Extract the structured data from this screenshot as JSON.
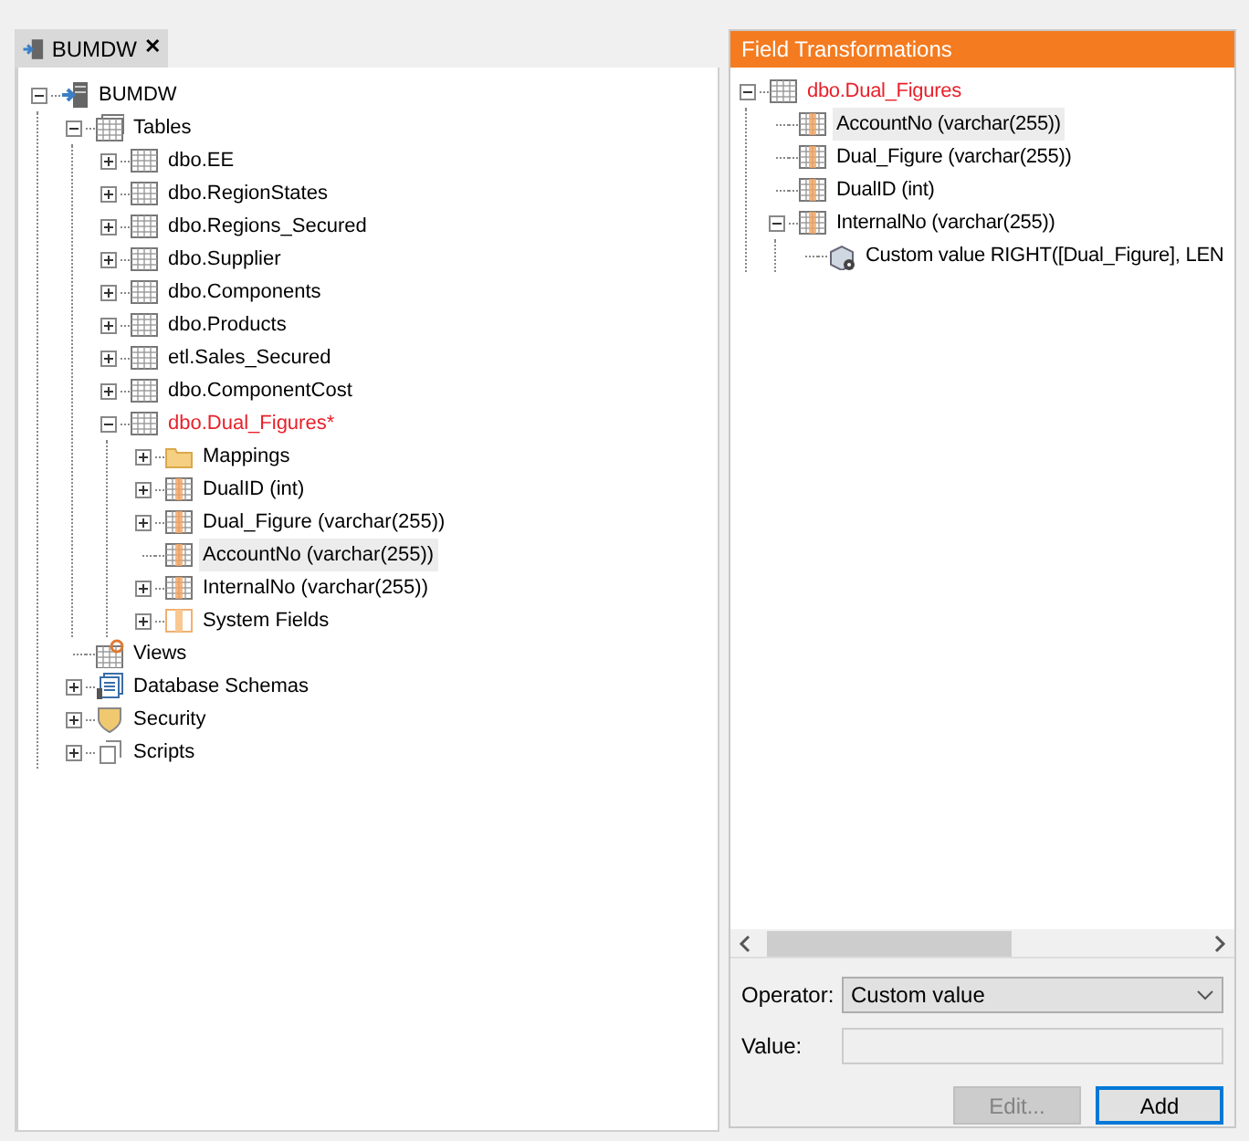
{
  "tab": {
    "title": "BUMDW",
    "close": "✕"
  },
  "tree": [
    {
      "label": "BUMDW",
      "kind": "server",
      "expanded": true,
      "children": [
        {
          "label": "Tables",
          "kind": "tables",
          "expanded": true,
          "children": [
            {
              "label": "dbo.EE",
              "kind": "table",
              "expanded": false
            },
            {
              "label": "dbo.RegionStates",
              "kind": "table",
              "expanded": false
            },
            {
              "label": "dbo.Regions_Secured",
              "kind": "table",
              "expanded": false
            },
            {
              "label": "dbo.Supplier",
              "kind": "table",
              "expanded": false
            },
            {
              "label": "dbo.Components",
              "kind": "table",
              "expanded": false
            },
            {
              "label": "dbo.Products",
              "kind": "table",
              "expanded": false
            },
            {
              "label": "etl.Sales_Secured",
              "kind": "table",
              "expanded": false
            },
            {
              "label": "dbo.ComponentCost",
              "kind": "table",
              "expanded": false
            },
            {
              "label": "dbo.Dual_Figures*",
              "kind": "table",
              "expanded": true,
              "modified": true,
              "children": [
                {
                  "label": "Mappings",
                  "kind": "folder",
                  "expanded": false
                },
                {
                  "label": "DualID (int)",
                  "kind": "column",
                  "expanded": false
                },
                {
                  "label": "Dual_Figure (varchar(255))",
                  "kind": "column",
                  "expanded": false
                },
                {
                  "label": "AccountNo (varchar(255))",
                  "kind": "column",
                  "selected": true
                },
                {
                  "label": "InternalNo (varchar(255))",
                  "kind": "column",
                  "expanded": false
                },
                {
                  "label": "System Fields",
                  "kind": "system-fields",
                  "expanded": false
                }
              ]
            }
          ]
        },
        {
          "label": "Views",
          "kind": "views"
        },
        {
          "label": "Database Schemas",
          "kind": "schemas",
          "expanded": false
        },
        {
          "label": "Security",
          "kind": "security",
          "expanded": false
        },
        {
          "label": "Scripts",
          "kind": "scripts",
          "expanded": false
        }
      ]
    }
  ],
  "transformations": {
    "title": "Field Transformations",
    "tree": [
      {
        "label": "dbo.Dual_Figures",
        "kind": "table",
        "expanded": true,
        "modified": true,
        "children": [
          {
            "label": "AccountNo (varchar(255))",
            "kind": "column",
            "selected": true
          },
          {
            "label": "Dual_Figure (varchar(255))",
            "kind": "column"
          },
          {
            "label": "DualID (int)",
            "kind": "column"
          },
          {
            "label": "InternalNo (varchar(255))",
            "kind": "column",
            "expanded": true,
            "children": [
              {
                "label": "Custom value RIGHT([Dual_Figure], LEN",
                "kind": "custom-value"
              }
            ]
          }
        ]
      }
    ],
    "operator": {
      "label": "Operator:",
      "value": "Custom value"
    },
    "value_field": {
      "label": "Value:",
      "disabled": true
    },
    "buttons": [
      {
        "label": "Edit...",
        "disabled": true,
        "default": false
      },
      {
        "label": "Add",
        "disabled": false,
        "default": true
      }
    ]
  }
}
